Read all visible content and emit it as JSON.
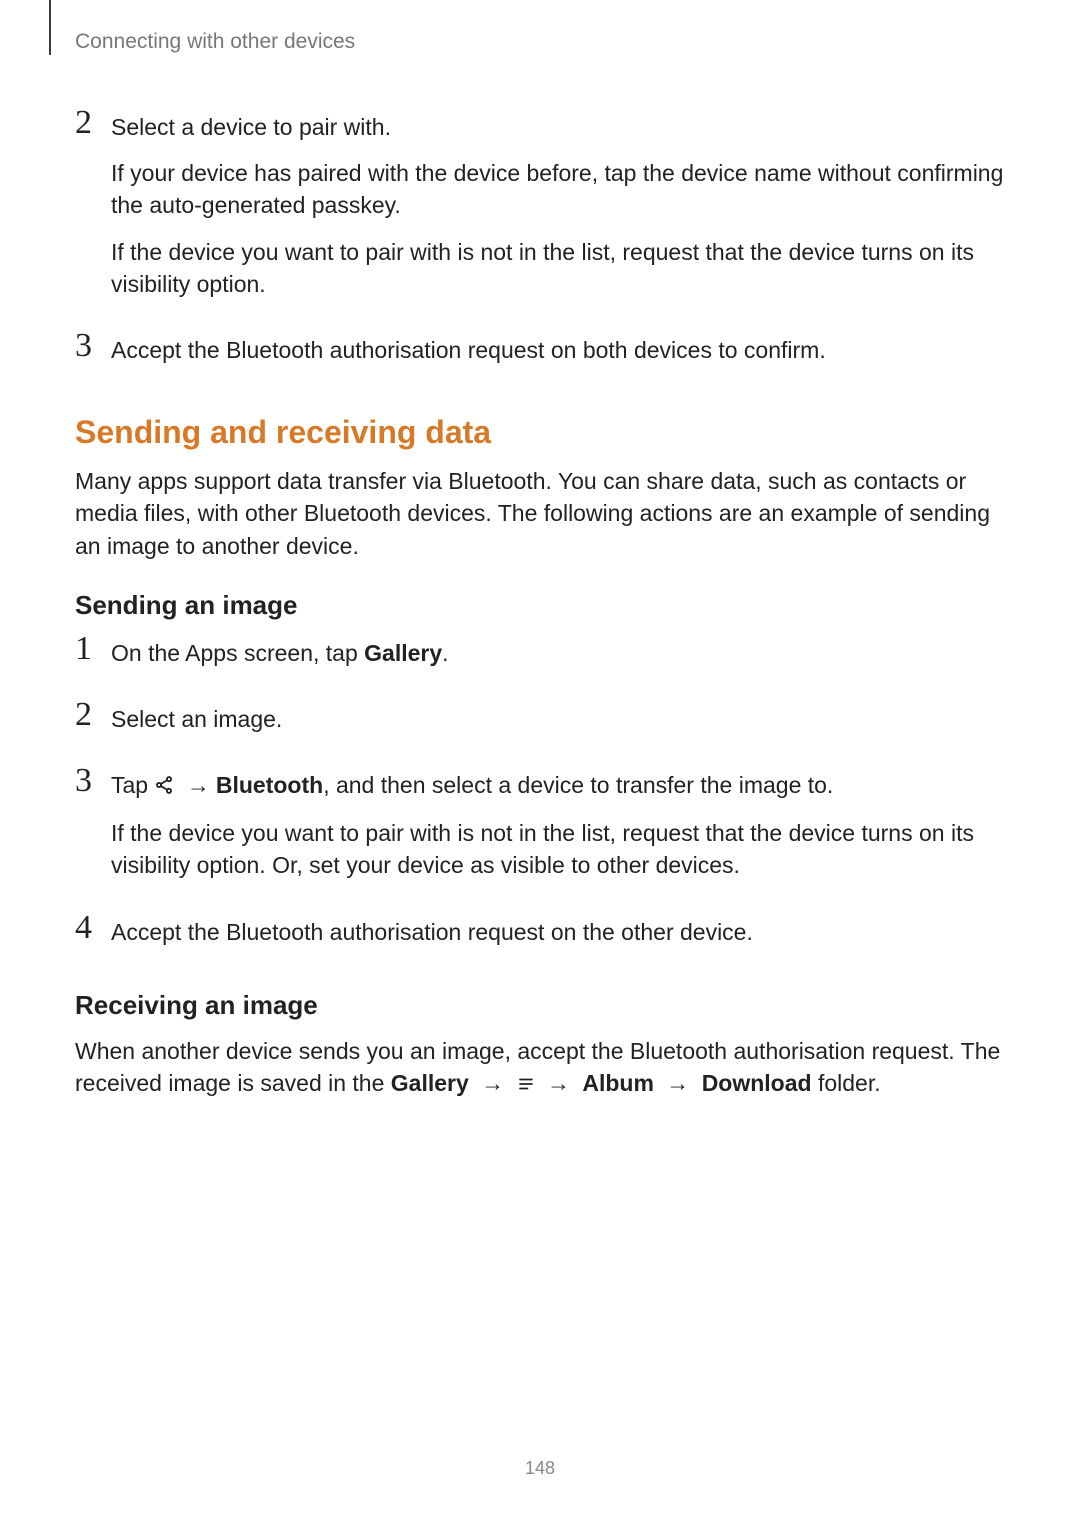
{
  "header": {
    "running_title": "Connecting with other devices"
  },
  "section1": {
    "step2": {
      "num": "2",
      "line1": "Select a device to pair with.",
      "line2": "If your device has paired with the device before, tap the device name without confirming the auto-generated passkey.",
      "line3": "If the device you want to pair with is not in the list, request that the device turns on its visibility option."
    },
    "step3": {
      "num": "3",
      "line1": "Accept the Bluetooth authorisation request on both devices to confirm."
    }
  },
  "section2": {
    "title": "Sending and receiving data",
    "intro": "Many apps support data transfer via Bluetooth. You can share data, such as contacts or media files, with other Bluetooth devices. The following actions are an example of sending an image to another device."
  },
  "sending": {
    "title": "Sending an image",
    "step1": {
      "num": "1",
      "prefix": "On the Apps screen, tap ",
      "bold": "Gallery",
      "suffix": "."
    },
    "step2": {
      "num": "2",
      "line1": "Select an image."
    },
    "step3": {
      "num": "3",
      "prefix": "Tap ",
      "arrow": "→",
      "bold": "Bluetooth",
      "suffix": ", and then select a device to transfer the image to.",
      "line2": "If the device you want to pair with is not in the list, request that the device turns on its visibility option. Or, set your device as visible to other devices."
    },
    "step4": {
      "num": "4",
      "line1": "Accept the Bluetooth authorisation request on the other device."
    }
  },
  "receiving": {
    "title": "Receiving an image",
    "p_prefix": "When another device sends you an image, accept the Bluetooth authorisation request. The received image is saved in the ",
    "b1": "Gallery",
    "arrow": "→",
    "b2": "Album",
    "b3": "Download",
    "p_suffix": " folder."
  },
  "page_number": "148",
  "colors": {
    "accent": "#d77a28"
  }
}
